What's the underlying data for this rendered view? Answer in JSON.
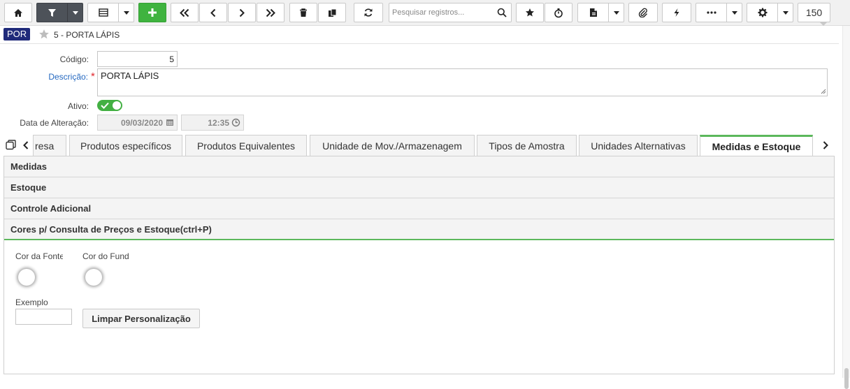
{
  "toolbar": {
    "search_placeholder": "Pesquisar registros...",
    "record_count": "150",
    "buttons": [
      {
        "name": "home-button",
        "icon": "home-icon"
      },
      {
        "name": "filter-button",
        "icon": "filter-icon"
      },
      {
        "name": "grid-view-button",
        "icon": "grid-icon"
      },
      {
        "name": "add-record-button",
        "icon": "plus-icon"
      },
      {
        "name": "first-record-button",
        "icon": "double-chevron-left-icon"
      },
      {
        "name": "previous-record-button",
        "icon": "chevron-left-icon"
      },
      {
        "name": "next-record-button",
        "icon": "chevron-right-icon"
      },
      {
        "name": "last-record-button",
        "icon": "double-chevron-right-icon"
      },
      {
        "name": "delete-button",
        "icon": "trash-icon"
      },
      {
        "name": "copy-button",
        "icon": "copy-icon"
      },
      {
        "name": "refresh-button",
        "icon": "refresh-icon"
      },
      {
        "name": "favorite-button",
        "icon": "star-icon"
      },
      {
        "name": "timer-button",
        "icon": "stopwatch-icon"
      },
      {
        "name": "report-button",
        "icon": "document-icon"
      },
      {
        "name": "attachment-button",
        "icon": "paperclip-icon"
      },
      {
        "name": "action-button",
        "icon": "lightning-icon"
      },
      {
        "name": "more-button",
        "icon": "ellipsis-icon"
      },
      {
        "name": "settings-button",
        "icon": "gear-icon"
      }
    ]
  },
  "header": {
    "module": "POR",
    "title": "5 - PORTA LÁPIS"
  },
  "form": {
    "codigo_label": "Código:",
    "codigo_value": "5",
    "descricao_label": "Descrição:",
    "descricao_value": "PORTA LÁPIS",
    "ativo_label": "Ativo:",
    "ativo_value": true,
    "data_alteracao_label": "Data de Alteração:",
    "data_value": "09/03/2020",
    "hora_value": "12:35"
  },
  "tabs": [
    {
      "label": "resa",
      "active": false
    },
    {
      "label": "Produtos específicos",
      "active": false
    },
    {
      "label": "Produtos Equivalentes",
      "active": false
    },
    {
      "label": "Unidade de Mov./Armazenagem",
      "active": false
    },
    {
      "label": "Tipos de Amostra",
      "active": false
    },
    {
      "label": "Unidades Alternativas",
      "active": false
    },
    {
      "label": "Medidas e Estoque",
      "active": true
    }
  ],
  "sections": [
    {
      "label": "Medidas",
      "open": false
    },
    {
      "label": "Estoque",
      "open": false
    },
    {
      "label": "Controle Adicional",
      "open": false
    },
    {
      "label": "Cores p/ Consulta de Preços e Estoque(ctrl+P)",
      "open": true
    }
  ],
  "colors_section": {
    "cor_fonte_label": "Cor da Fonte",
    "cor_fundo_label": "Cor do Fund",
    "exemplo_label": "Exemplo",
    "exemplo_value": "",
    "clear_button_label": "Limpar Personalização"
  },
  "colors": {
    "accent_green": "#5cb85c",
    "add_button_green": "#3fb33f",
    "module_badge": "#1f2a7a",
    "required_star": "#e0282e",
    "required_label": "#2468c0"
  }
}
